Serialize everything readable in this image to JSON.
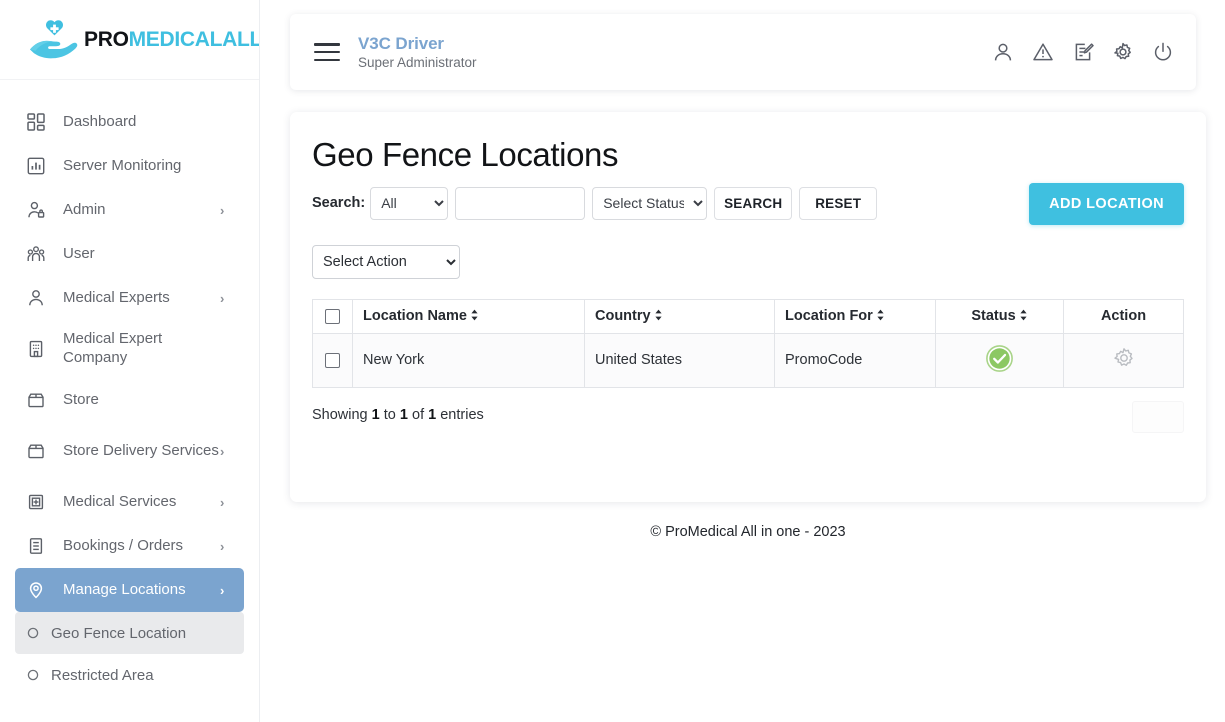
{
  "brand": {
    "logo_icon": "hand-heart-cross-icon",
    "name_primary": "PRO",
    "name_secondary": "MEDICALALL",
    "accent_color": "#3fbfe0"
  },
  "sidebar": {
    "active_color": "#7ba4cf",
    "items": [
      {
        "label": "Dashboard",
        "icon": "dashboard-grid-icon",
        "caret": "",
        "active": false
      },
      {
        "label": "Server Monitoring",
        "icon": "bar-chart-icon",
        "caret": "",
        "active": false
      },
      {
        "label": "Admin",
        "icon": "user-lock-icon",
        "caret": "›",
        "active": false
      },
      {
        "label": "User",
        "icon": "users-group-icon",
        "caret": "",
        "active": false
      },
      {
        "label": "Medical Experts",
        "icon": "person-icon",
        "caret": "›",
        "active": false
      },
      {
        "label": "Medical Expert Company",
        "icon": "building-icon",
        "caret": "",
        "active": false
      },
      {
        "label": "Store",
        "icon": "store-icon",
        "caret": "",
        "active": false
      },
      {
        "label": "Store Delivery Services",
        "icon": "store-icon",
        "caret": "›",
        "active": false
      },
      {
        "label": "Medical Services",
        "icon": "hospital-icon",
        "caret": "›",
        "active": false
      },
      {
        "label": "Bookings / Orders",
        "icon": "document-list-icon",
        "caret": "›",
        "active": false
      },
      {
        "label": "Manage Locations",
        "icon": "map-pin-icon",
        "caret": "›",
        "active": true
      }
    ],
    "sub_items": [
      {
        "label": "Geo Fence Location",
        "icon": "circle-outline-icon",
        "selected": true
      },
      {
        "label": "Restricted Area",
        "icon": "circle-outline-icon",
        "selected": false
      }
    ]
  },
  "topbar": {
    "menu_icon": "hamburger-menu-icon",
    "title": "V3C Driver",
    "subtitle": "Super Administrator",
    "icons": [
      {
        "name": "user-profile-icon"
      },
      {
        "name": "warning-triangle-icon"
      },
      {
        "name": "edit-document-icon"
      },
      {
        "name": "settings-gear-icon"
      },
      {
        "name": "power-logout-icon"
      }
    ]
  },
  "page": {
    "title": "Geo Fence Locations"
  },
  "filters": {
    "search_label": "Search:",
    "field_select": {
      "value": "All",
      "options": [
        "All"
      ]
    },
    "search_input": {
      "value": "",
      "placeholder": ""
    },
    "status_select": {
      "value": "Select Status",
      "options": [
        "Select Status"
      ]
    },
    "search_button": "SEARCH",
    "reset_button": "RESET",
    "add_button": "ADD LOCATION",
    "add_button_color": "#3fc0e0"
  },
  "bulk": {
    "action_select": {
      "value": "Select Action",
      "options": [
        "Select Action"
      ]
    }
  },
  "table": {
    "columns": [
      {
        "key": "check",
        "label": "",
        "sortable": false
      },
      {
        "key": "name",
        "label": "Location Name",
        "sortable": true
      },
      {
        "key": "country",
        "label": "Country",
        "sortable": true
      },
      {
        "key": "locfor",
        "label": "Location For",
        "sortable": true
      },
      {
        "key": "status",
        "label": "Status",
        "sortable": true
      },
      {
        "key": "action",
        "label": "Action",
        "sortable": false
      }
    ],
    "rows": [
      {
        "checked": false,
        "name": "New York",
        "country": "United States",
        "location_for": "PromoCode",
        "status": "active",
        "status_icon": "green-check-circle-icon",
        "status_color": "#8cc863",
        "action_icon": "settings-gear-icon"
      }
    ]
  },
  "pagination": {
    "showing_prefix": "Showing",
    "from": "1",
    "to_word": "to",
    "to": "1",
    "of_word": "of",
    "total": "1",
    "entries_word": "entries"
  },
  "footer": {
    "text": "© ProMedical All in one - 2023"
  }
}
